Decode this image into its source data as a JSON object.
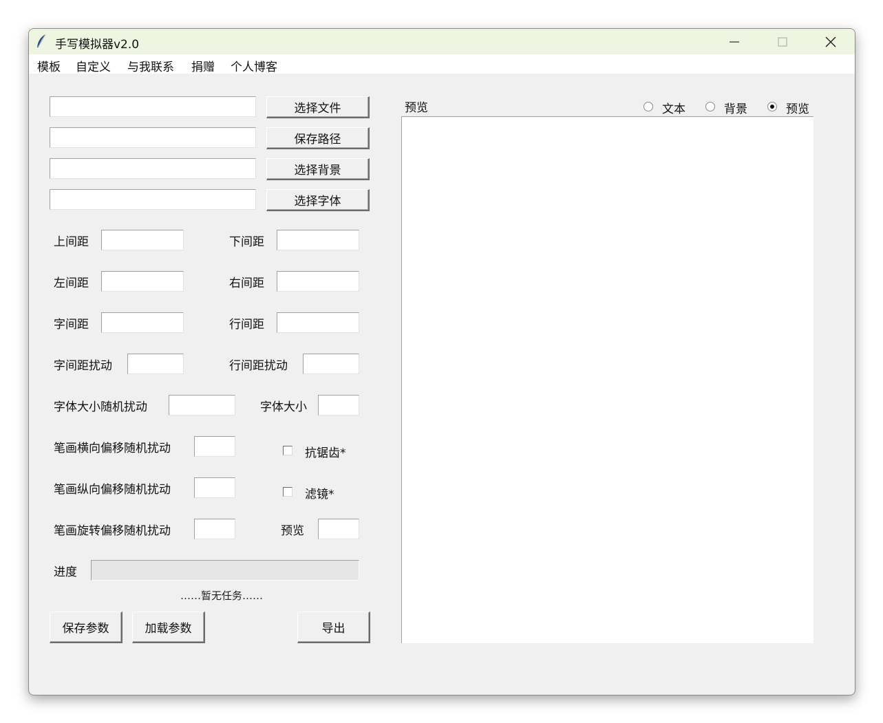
{
  "window": {
    "title": "手写模拟器v2.0",
    "minimize_glyph": "—",
    "maximize_glyph": "☐",
    "close_glyph": "✕"
  },
  "menu": [
    "模板",
    "自定义",
    "与我联系",
    "捐赠",
    "个人博客"
  ],
  "file_rows": [
    {
      "value": "",
      "button": "选择文件"
    },
    {
      "value": "",
      "button": "保存路径"
    },
    {
      "value": "",
      "button": "选择背景"
    },
    {
      "value": "",
      "button": "选择字体"
    }
  ],
  "params": {
    "top_margin": "上间距",
    "bottom_margin": "下间距",
    "left_margin": "左间距",
    "right_margin": "右间距",
    "char_spacing": "字间距",
    "line_spacing": "行间距",
    "char_spacing_jitter": "字间距扰动",
    "line_spacing_jitter": "行间距扰动",
    "font_size_jitter": "字体大小随机扰动",
    "font_size": "字体大小",
    "stroke_h_jitter": "笔画横向偏移随机扰动",
    "stroke_v_jitter": "笔画纵向偏移随机扰动",
    "stroke_rot_jitter": "笔画旋转偏移随机扰动",
    "preview_pages": "预览",
    "antialias": "抗锯齿*",
    "filter": "滤镜*"
  },
  "progress": {
    "label": "进度",
    "value": 0
  },
  "status_text": "……暂无任务……",
  "buttons": {
    "save_params": "保存参数",
    "load_params": "加载参数",
    "export": "导出"
  },
  "preview": {
    "label": "预览",
    "radios": [
      {
        "label": "文本",
        "checked": false
      },
      {
        "label": "背景",
        "checked": false
      },
      {
        "label": "预览",
        "checked": true
      }
    ]
  }
}
